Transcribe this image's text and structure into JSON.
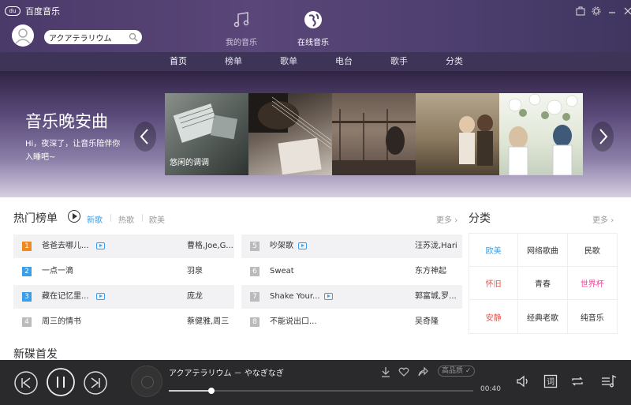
{
  "app": {
    "title": "百度音乐",
    "logo_mark": "du"
  },
  "search": {
    "value": "アクアテラリウム"
  },
  "top_tabs": [
    {
      "label": "我的音乐",
      "icon": "music-note-icon"
    },
    {
      "label": "在线音乐",
      "icon": "globe-icon"
    }
  ],
  "nav": [
    "首页",
    "榜单",
    "歌单",
    "电台",
    "歌手",
    "分类"
  ],
  "banner": {
    "title": "音乐晚安曲",
    "subtitle": "Hi，夜深了，让音乐陪伴你入睡吧~",
    "first_caption": "悠闲的调调"
  },
  "hot": {
    "title": "热门榜单",
    "subtabs": [
      "新歌",
      "热歌",
      "欧美"
    ],
    "more": "更多",
    "left": [
      {
        "rank": "1",
        "song": "爸爸去哪儿...",
        "artist": "曹格,Joe,G...",
        "mv": true
      },
      {
        "rank": "2",
        "song": "一点一滴",
        "artist": "羽泉",
        "mv": false
      },
      {
        "rank": "3",
        "song": "藏在记忆里...",
        "artist": "庞龙",
        "mv": true
      },
      {
        "rank": "4",
        "song": "周三的情书",
        "artist": "蔡健雅,周三",
        "mv": false
      }
    ],
    "right": [
      {
        "rank": "5",
        "song": "吵架歌",
        "artist": "汪苏泷,Hari",
        "mv": true
      },
      {
        "rank": "6",
        "song": "Sweat",
        "artist": "东方神起",
        "mv": false
      },
      {
        "rank": "7",
        "song": "Shake Your...",
        "artist": "郭富城,罗...",
        "mv": true
      },
      {
        "rank": "8",
        "song": "不能说出口...",
        "artist": "吴奇隆",
        "mv": false
      }
    ]
  },
  "categories": {
    "title": "分类",
    "more": "更多",
    "items": [
      {
        "label": "欧美",
        "color": "#3a9ee8"
      },
      {
        "label": "网络歌曲",
        "color": "#333333"
      },
      {
        "label": "民歌",
        "color": "#333333"
      },
      {
        "label": "怀旧",
        "color": "#e8534a"
      },
      {
        "label": "青春",
        "color": "#333333"
      },
      {
        "label": "世界杯",
        "color": "#e84a9a"
      },
      {
        "label": "安静",
        "color": "#e8534a"
      },
      {
        "label": "经典老歌",
        "color": "#333333"
      },
      {
        "label": "纯音乐",
        "color": "#333333"
      }
    ]
  },
  "new_albums": {
    "title": "新碟首发"
  },
  "player": {
    "track": "アクアテラリウム － やなぎなぎ",
    "time": "00:40",
    "quality": "高品质",
    "progress": 0.14
  },
  "colors": {
    "accent": "#3a9ee8",
    "rank_hot": "#f08a1e",
    "rank_blue": "#3a9ee8",
    "rank_gray": "#bbbbbb"
  }
}
